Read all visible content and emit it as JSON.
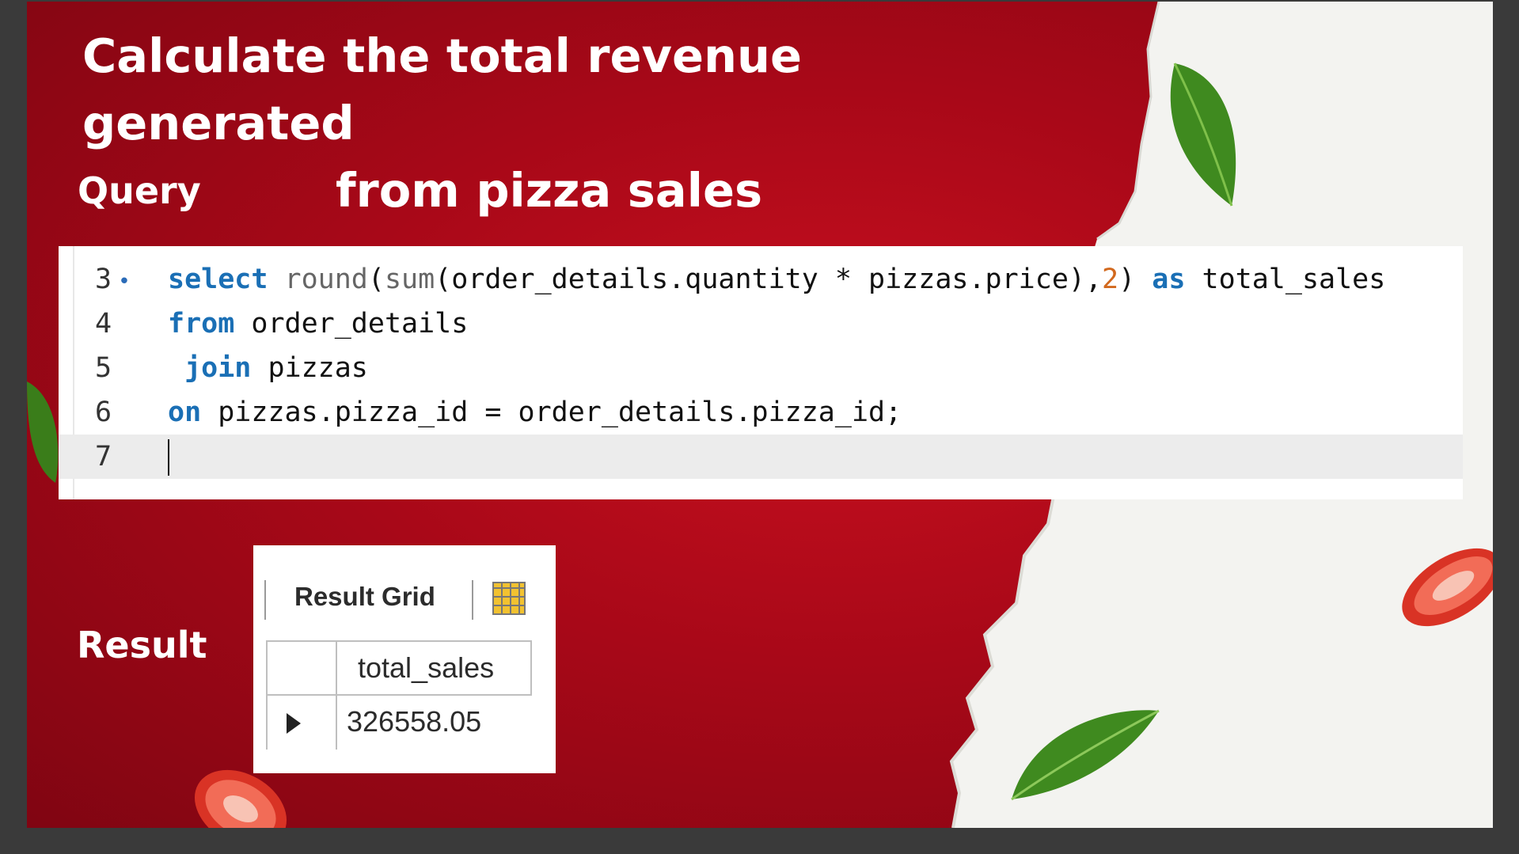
{
  "slide": {
    "title_line1": "Calculate the total revenue generated",
    "title_line2": "from pizza sales",
    "query_label": "Query",
    "result_label": "Result"
  },
  "editor": {
    "lines": [
      {
        "number": "3",
        "marker": "•",
        "tokens": [
          {
            "text": "select",
            "kind": "keyword"
          },
          {
            "text": " ",
            "kind": "plain"
          },
          {
            "text": "round",
            "kind": "function"
          },
          {
            "text": "(",
            "kind": "plain"
          },
          {
            "text": "sum",
            "kind": "function"
          },
          {
            "text": "(order_details.quantity * pizzas.price),",
            "kind": "plain"
          },
          {
            "text": "2",
            "kind": "number"
          },
          {
            "text": ") ",
            "kind": "plain"
          },
          {
            "text": "as",
            "kind": "keyword"
          },
          {
            "text": " total_sales",
            "kind": "plain"
          }
        ]
      },
      {
        "number": "4",
        "marker": "",
        "tokens": [
          {
            "text": "from",
            "kind": "keyword"
          },
          {
            "text": " order_details",
            "kind": "plain"
          }
        ]
      },
      {
        "number": "5",
        "marker": "",
        "tokens": [
          {
            "text": " ",
            "kind": "plain"
          },
          {
            "text": "join",
            "kind": "keyword"
          },
          {
            "text": " pizzas",
            "kind": "plain"
          }
        ]
      },
      {
        "number": "6",
        "marker": "",
        "tokens": [
          {
            "text": "on",
            "kind": "keyword"
          },
          {
            "text": " pizzas.pizza_id = order_details.pizza_id;",
            "kind": "plain"
          }
        ]
      },
      {
        "number": "7",
        "marker": "",
        "tokens": []
      }
    ],
    "current_line": "7",
    "colors": {
      "keyword": "#1a6fb5",
      "function": "#666666",
      "number": "#d2691e",
      "plain": "#111111"
    }
  },
  "result_grid": {
    "tab_label": "Result Grid",
    "grid_icon": "grid-layout-icon",
    "column_header": "total_sales",
    "rows": [
      {
        "indicator": "current-row-arrow-icon",
        "value": "326558.05"
      }
    ]
  },
  "decorations": [
    "basil-leaf",
    "tomato-slice"
  ],
  "colors": {
    "background": "#a80818",
    "paper": "#f4f4f1",
    "text": "#ffffff"
  }
}
